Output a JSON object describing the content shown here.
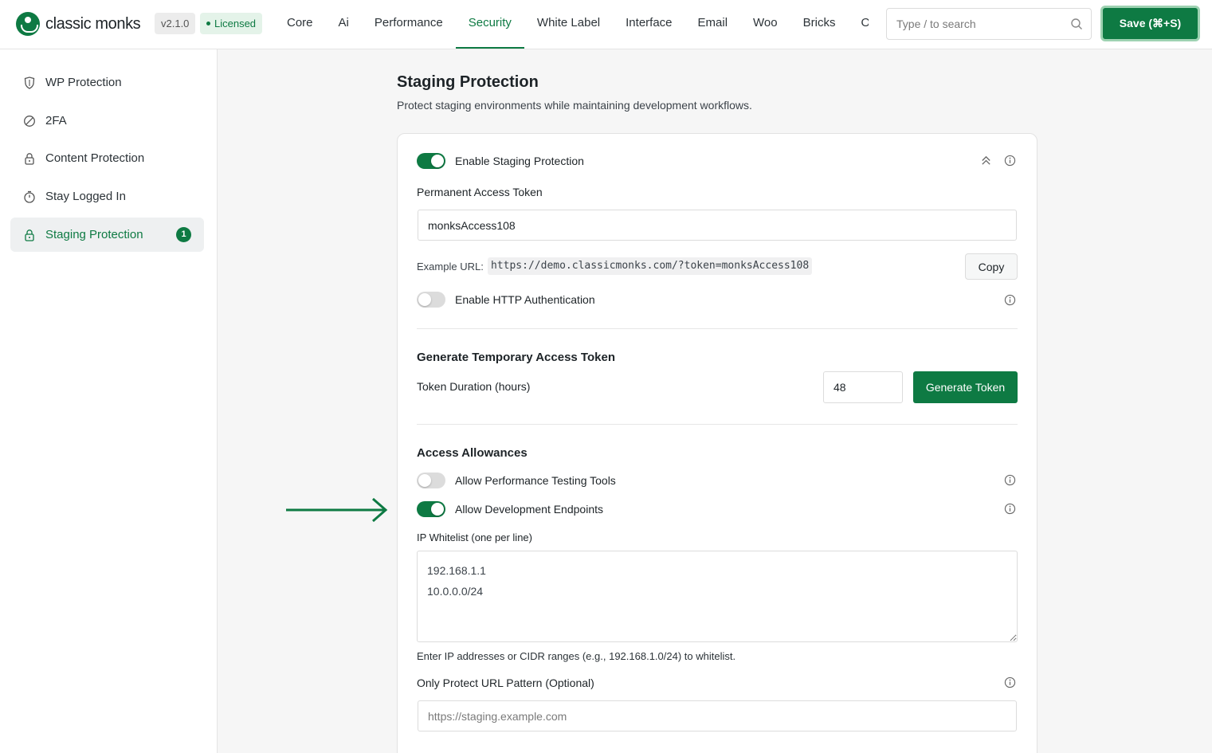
{
  "header": {
    "brand": "classic monks",
    "version": "v2.1.0",
    "license_label": "Licensed",
    "nav_tabs": [
      {
        "label": "Core",
        "active": false
      },
      {
        "label": "Ai",
        "active": false
      },
      {
        "label": "Performance",
        "active": false
      },
      {
        "label": "Security",
        "active": true
      },
      {
        "label": "White Label",
        "active": false
      },
      {
        "label": "Interface",
        "active": false
      },
      {
        "label": "Email",
        "active": false
      },
      {
        "label": "Woo",
        "active": false
      },
      {
        "label": "Bricks",
        "active": false
      },
      {
        "label": "Opt",
        "active": false
      }
    ],
    "search_placeholder": "Type / to search",
    "save_label": "Save (⌘+S)"
  },
  "sidebar": {
    "items": [
      {
        "label": "WP Protection",
        "icon": "shield-icon",
        "active": false
      },
      {
        "label": "2FA",
        "icon": "slashed-circle-icon",
        "active": false
      },
      {
        "label": "Content Protection",
        "icon": "lock-icon",
        "active": false
      },
      {
        "label": "Stay Logged In",
        "icon": "timer-icon",
        "active": false
      },
      {
        "label": "Staging Protection",
        "icon": "lock-icon",
        "active": true,
        "badge": "1"
      }
    ]
  },
  "main": {
    "title": "Staging Protection",
    "description": "Protect staging environments while maintaining development workflows.",
    "enable_staging": {
      "label": "Enable Staging Protection",
      "enabled": true
    },
    "permanent_token": {
      "label": "Permanent Access Token",
      "value": "monksAccess108"
    },
    "example_url": {
      "label": "Example URL:",
      "url": "https://demo.classicmonks.com/?token=monksAccess108",
      "copy_label": "Copy"
    },
    "http_auth": {
      "label": "Enable HTTP Authentication",
      "enabled": false
    },
    "temp_token": {
      "heading": "Generate Temporary Access Token",
      "duration_label": "Token Duration (hours)",
      "duration_value": "48",
      "button_label": "Generate Token"
    },
    "allowances": {
      "heading": "Access Allowances",
      "performance_tools": {
        "label": "Allow Performance Testing Tools",
        "enabled": false
      },
      "dev_endpoints": {
        "label": "Allow Development Endpoints",
        "enabled": true
      }
    },
    "ip_whitelist": {
      "label": "IP Whitelist (one per line)",
      "value": "192.168.1.1\n10.0.0.0/24",
      "hint": "Enter IP addresses or CIDR ranges (e.g., 192.168.1.0/24) to whitelist."
    },
    "url_pattern": {
      "label": "Only Protect URL Pattern (Optional)",
      "placeholder": "https://staging.example.com"
    }
  },
  "colors": {
    "accent": "#0e7a43",
    "active_tab_bg": "#e4f3e9",
    "sidebar_active_bg": "#eef0f1"
  }
}
